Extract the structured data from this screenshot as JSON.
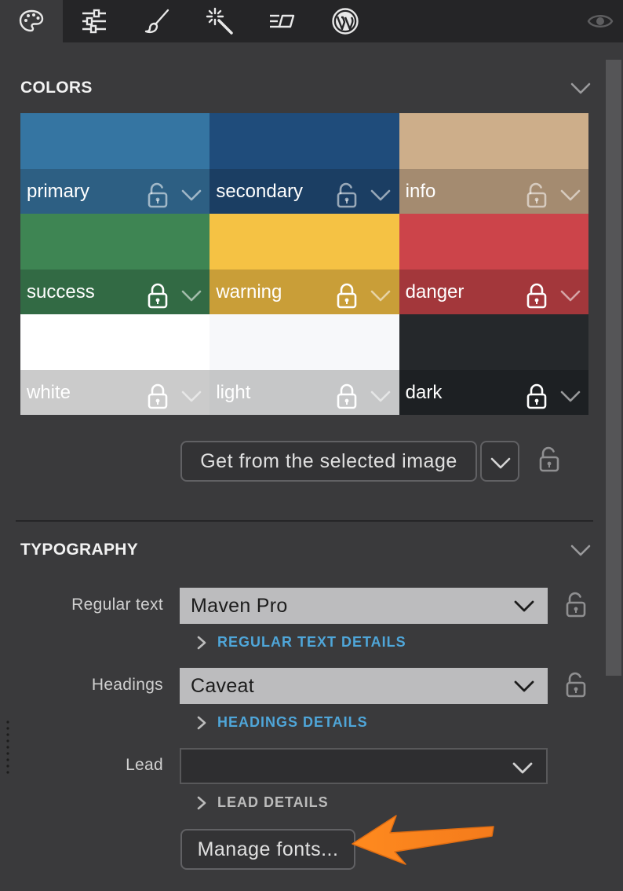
{
  "toolbar": {
    "tools": [
      "palette-icon",
      "sliders-icon",
      "brush-icon",
      "magic-wand-icon",
      "text-align-icon",
      "wordpress-icon"
    ],
    "visibility_icon": "eye-icon"
  },
  "colors_section": {
    "title": "COLORS",
    "swatches": [
      {
        "name": "primary",
        "color": "#3575a2",
        "bar_color": "#2d5f83",
        "text_color": "#ffffff",
        "locked": false
      },
      {
        "name": "secondary",
        "color": "#1f4c7b",
        "bar_color": "#1b3e63",
        "text_color": "#ffffff",
        "locked": false
      },
      {
        "name": "info",
        "color": "#cdae8a",
        "bar_color": "#a48b70",
        "text_color": "#ffffff",
        "locked": false
      },
      {
        "name": "success",
        "color": "#3e8553",
        "bar_color": "#326a44",
        "text_color": "#ffffff",
        "locked": true
      },
      {
        "name": "warning",
        "color": "#f5c244",
        "bar_color": "#c99e38",
        "text_color": "#ffffff",
        "locked": true
      },
      {
        "name": "danger",
        "color": "#cc444a",
        "bar_color": "#a3373b",
        "text_color": "#ffffff",
        "locked": true
      },
      {
        "name": "white",
        "color": "#ffffff",
        "bar_color": "#cbcbcb",
        "text_color": "#ffffff",
        "locked": true
      },
      {
        "name": "light",
        "color": "#f7f8fa",
        "bar_color": "#c6c7c8",
        "text_color": "#ffffff",
        "locked": true
      },
      {
        "name": "dark",
        "color": "#25282b",
        "bar_color": "#1d2023",
        "text_color": "#ffffff",
        "locked": true
      }
    ],
    "get_from_image_label": "Get from the selected image"
  },
  "typography_section": {
    "title": "TYPOGRAPHY",
    "rows": [
      {
        "label": "Regular text",
        "value": "Maven Pro",
        "details_label": "REGULAR TEXT DETAILS"
      },
      {
        "label": "Headings",
        "value": "Caveat",
        "details_label": "HEADINGS DETAILS"
      },
      {
        "label": "Lead",
        "value": "",
        "details_label": "LEAD DETAILS"
      }
    ],
    "manage_fonts_label": "Manage fonts..."
  },
  "accent_colors": {
    "link_blue": "#4fa6d9",
    "callout_orange": "#f7811f"
  }
}
